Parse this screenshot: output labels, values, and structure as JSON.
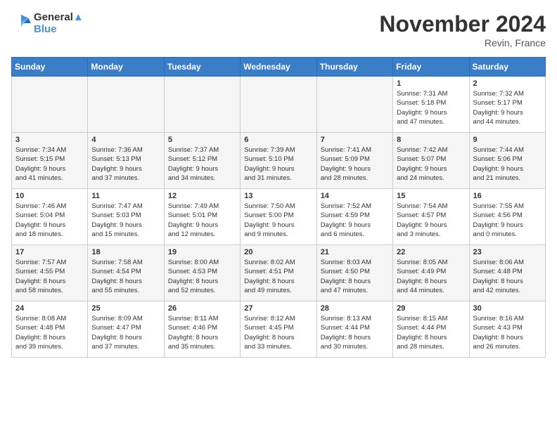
{
  "header": {
    "logo_line1": "General",
    "logo_line2": "Blue",
    "month_title": "November 2024",
    "location": "Revin, France"
  },
  "days_of_week": [
    "Sunday",
    "Monday",
    "Tuesday",
    "Wednesday",
    "Thursday",
    "Friday",
    "Saturday"
  ],
  "weeks": [
    [
      {
        "day": "",
        "info": ""
      },
      {
        "day": "",
        "info": ""
      },
      {
        "day": "",
        "info": ""
      },
      {
        "day": "",
        "info": ""
      },
      {
        "day": "",
        "info": ""
      },
      {
        "day": "1",
        "info": "Sunrise: 7:31 AM\nSunset: 5:18 PM\nDaylight: 9 hours\nand 47 minutes."
      },
      {
        "day": "2",
        "info": "Sunrise: 7:32 AM\nSunset: 5:17 PM\nDaylight: 9 hours\nand 44 minutes."
      }
    ],
    [
      {
        "day": "3",
        "info": "Sunrise: 7:34 AM\nSunset: 5:15 PM\nDaylight: 9 hours\nand 41 minutes."
      },
      {
        "day": "4",
        "info": "Sunrise: 7:36 AM\nSunset: 5:13 PM\nDaylight: 9 hours\nand 37 minutes."
      },
      {
        "day": "5",
        "info": "Sunrise: 7:37 AM\nSunset: 5:12 PM\nDaylight: 9 hours\nand 34 minutes."
      },
      {
        "day": "6",
        "info": "Sunrise: 7:39 AM\nSunset: 5:10 PM\nDaylight: 9 hours\nand 31 minutes."
      },
      {
        "day": "7",
        "info": "Sunrise: 7:41 AM\nSunset: 5:09 PM\nDaylight: 9 hours\nand 28 minutes."
      },
      {
        "day": "8",
        "info": "Sunrise: 7:42 AM\nSunset: 5:07 PM\nDaylight: 9 hours\nand 24 minutes."
      },
      {
        "day": "9",
        "info": "Sunrise: 7:44 AM\nSunset: 5:06 PM\nDaylight: 9 hours\nand 21 minutes."
      }
    ],
    [
      {
        "day": "10",
        "info": "Sunrise: 7:46 AM\nSunset: 5:04 PM\nDaylight: 9 hours\nand 18 minutes."
      },
      {
        "day": "11",
        "info": "Sunrise: 7:47 AM\nSunset: 5:03 PM\nDaylight: 9 hours\nand 15 minutes."
      },
      {
        "day": "12",
        "info": "Sunrise: 7:49 AM\nSunset: 5:01 PM\nDaylight: 9 hours\nand 12 minutes."
      },
      {
        "day": "13",
        "info": "Sunrise: 7:50 AM\nSunset: 5:00 PM\nDaylight: 9 hours\nand 9 minutes."
      },
      {
        "day": "14",
        "info": "Sunrise: 7:52 AM\nSunset: 4:59 PM\nDaylight: 9 hours\nand 6 minutes."
      },
      {
        "day": "15",
        "info": "Sunrise: 7:54 AM\nSunset: 4:57 PM\nDaylight: 9 hours\nand 3 minutes."
      },
      {
        "day": "16",
        "info": "Sunrise: 7:55 AM\nSunset: 4:56 PM\nDaylight: 9 hours\nand 0 minutes."
      }
    ],
    [
      {
        "day": "17",
        "info": "Sunrise: 7:57 AM\nSunset: 4:55 PM\nDaylight: 8 hours\nand 58 minutes."
      },
      {
        "day": "18",
        "info": "Sunrise: 7:58 AM\nSunset: 4:54 PM\nDaylight: 8 hours\nand 55 minutes."
      },
      {
        "day": "19",
        "info": "Sunrise: 8:00 AM\nSunset: 4:53 PM\nDaylight: 8 hours\nand 52 minutes."
      },
      {
        "day": "20",
        "info": "Sunrise: 8:02 AM\nSunset: 4:51 PM\nDaylight: 8 hours\nand 49 minutes."
      },
      {
        "day": "21",
        "info": "Sunrise: 8:03 AM\nSunset: 4:50 PM\nDaylight: 8 hours\nand 47 minutes."
      },
      {
        "day": "22",
        "info": "Sunrise: 8:05 AM\nSunset: 4:49 PM\nDaylight: 8 hours\nand 44 minutes."
      },
      {
        "day": "23",
        "info": "Sunrise: 8:06 AM\nSunset: 4:48 PM\nDaylight: 8 hours\nand 42 minutes."
      }
    ],
    [
      {
        "day": "24",
        "info": "Sunrise: 8:08 AM\nSunset: 4:48 PM\nDaylight: 8 hours\nand 39 minutes."
      },
      {
        "day": "25",
        "info": "Sunrise: 8:09 AM\nSunset: 4:47 PM\nDaylight: 8 hours\nand 37 minutes."
      },
      {
        "day": "26",
        "info": "Sunrise: 8:11 AM\nSunset: 4:46 PM\nDaylight: 8 hours\nand 35 minutes."
      },
      {
        "day": "27",
        "info": "Sunrise: 8:12 AM\nSunset: 4:45 PM\nDaylight: 8 hours\nand 33 minutes."
      },
      {
        "day": "28",
        "info": "Sunrise: 8:13 AM\nSunset: 4:44 PM\nDaylight: 8 hours\nand 30 minutes."
      },
      {
        "day": "29",
        "info": "Sunrise: 8:15 AM\nSunset: 4:44 PM\nDaylight: 8 hours\nand 28 minutes."
      },
      {
        "day": "30",
        "info": "Sunrise: 8:16 AM\nSunset: 4:43 PM\nDaylight: 8 hours\nand 26 minutes."
      }
    ]
  ]
}
